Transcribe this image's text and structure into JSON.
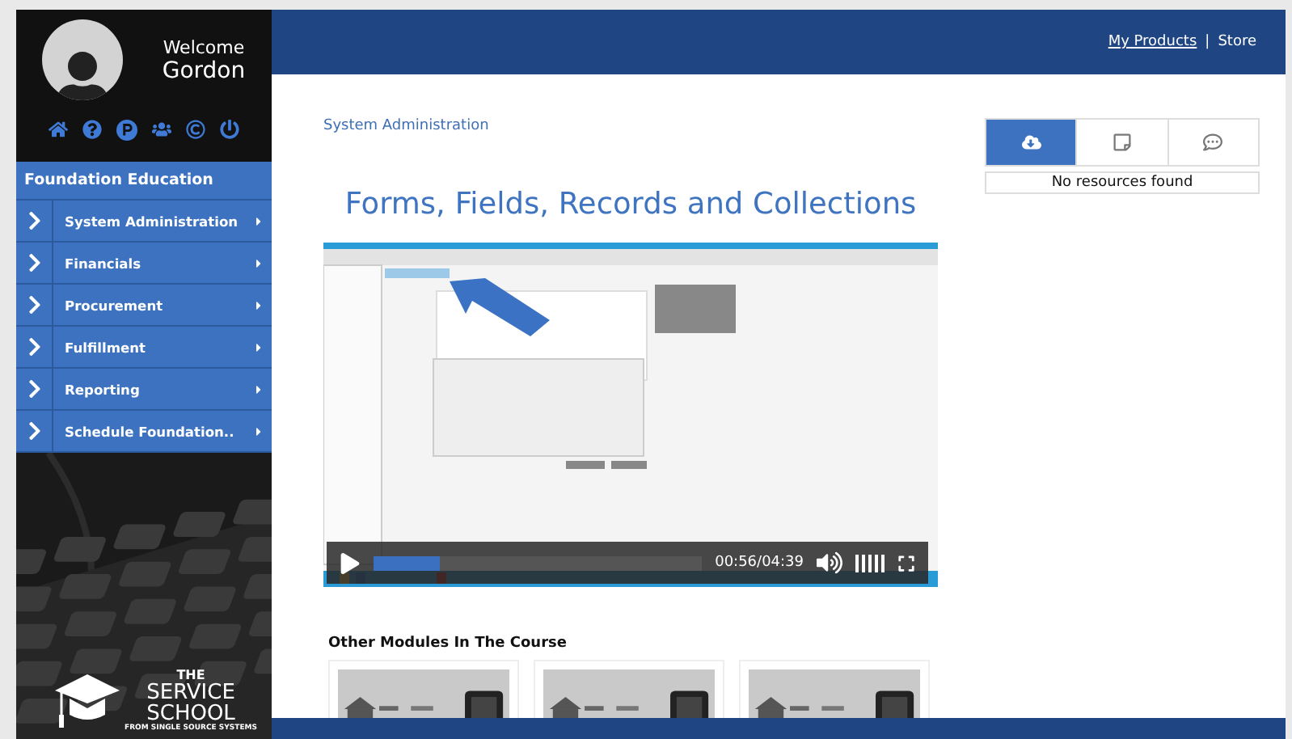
{
  "user": {
    "greeting": "Welcome",
    "name": "Gordon"
  },
  "sidebar": {
    "section": "Foundation Education",
    "items": [
      {
        "label": "System Administration",
        "selected": false
      },
      {
        "label": "Financials",
        "selected": false
      },
      {
        "label": "Procurement",
        "selected": false
      },
      {
        "label": "Fulfillment",
        "selected": false
      },
      {
        "label": "Reporting",
        "selected": false
      },
      {
        "label": "Schedule Foundation..",
        "selected": false
      }
    ],
    "logo": {
      "line_1": "THE",
      "line_2": "SERVICE",
      "line_3": "SCHOOL",
      "tagline": "FROM SINGLE SOURCE SYSTEMS"
    }
  },
  "header": {
    "links": [
      {
        "label": "My Products",
        "kind": "link"
      },
      {
        "label": "Store",
        "kind": "plain"
      }
    ],
    "separator": "|"
  },
  "breadcrumb": "System Administration",
  "title": "Forms, Fields, Records and Collections",
  "video": {
    "time": "00:56/04:39",
    "progress": {
      "level": 0.2
    }
  },
  "resources": {
    "tabs": [
      {
        "kind": "download",
        "selected": true
      },
      {
        "kind": "note",
        "selected": false
      },
      {
        "kind": "comment",
        "selected": false
      }
    ],
    "message": "No resources found"
  },
  "other_modules": {
    "heading": "Other Modules In The Course"
  }
}
